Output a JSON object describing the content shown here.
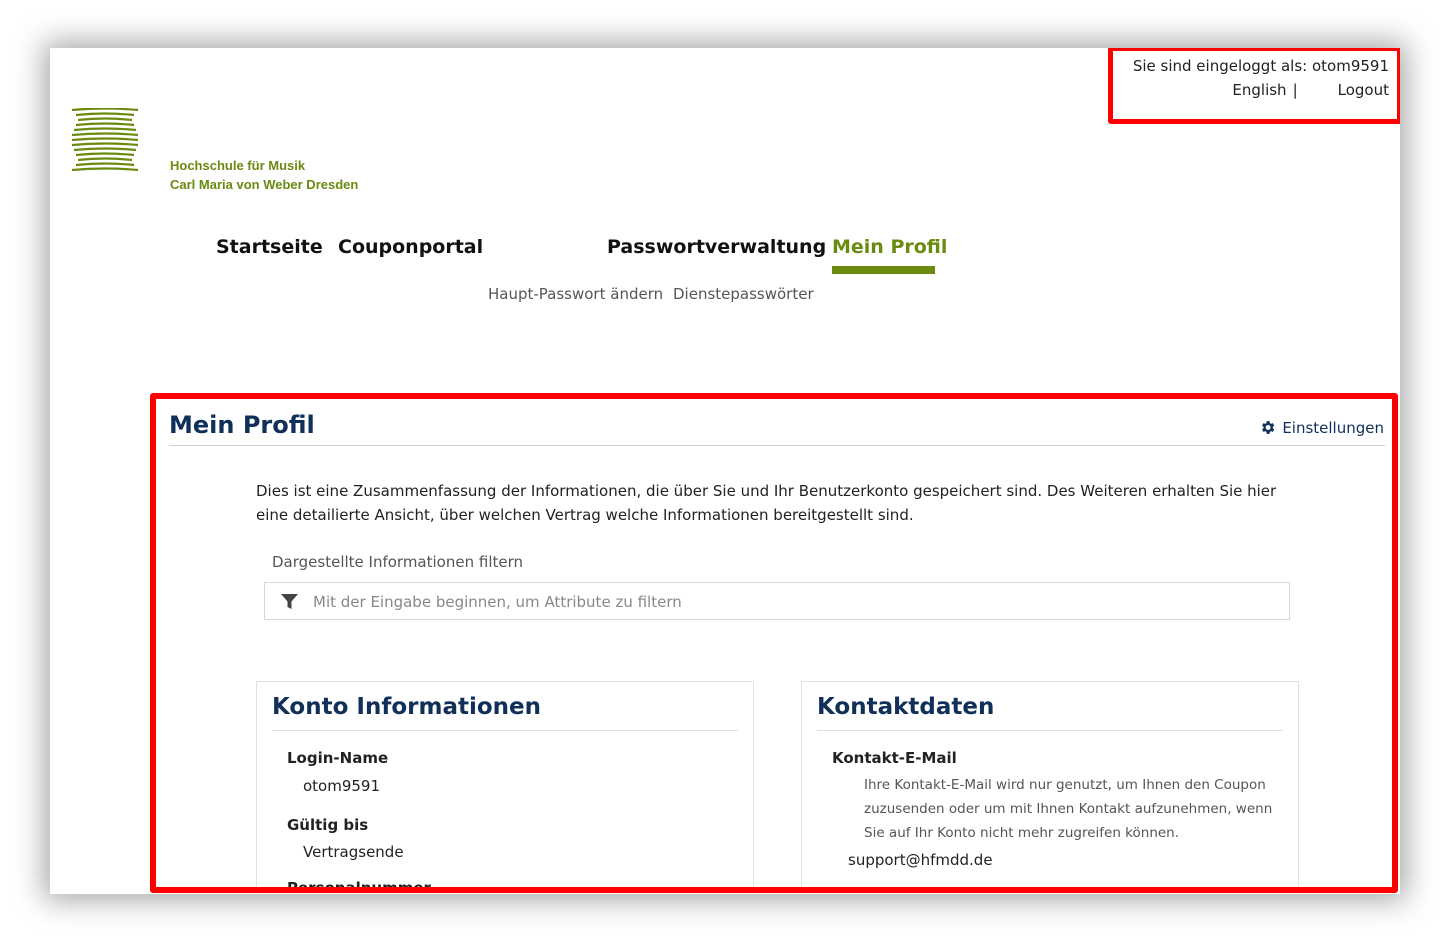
{
  "user": {
    "logged_in_text": "Sie sind eingeloggt als: otom9591",
    "language_link": "English",
    "separator": "|",
    "logout_link": "Logout"
  },
  "logo": {
    "line1": "Hochschule für Musik",
    "line2": "Carl Maria von Weber Dresden",
    "color": "#6a8a10"
  },
  "nav": {
    "items": [
      {
        "label": "Startseite"
      },
      {
        "label": "Couponportal"
      },
      {
        "label": "Passwortverwaltung"
      },
      {
        "label": "Mein Profil",
        "active": true
      }
    ],
    "subitems": [
      {
        "label": "Haupt-Passwort ändern"
      },
      {
        "label": "Dienstepasswörter"
      }
    ]
  },
  "main": {
    "title": "Mein Profil",
    "settings_label": "Einstellungen",
    "intro": "Dies ist eine Zusammenfassung der Informationen, die über Sie und Ihr Benutzerkonto gespeichert sind. Des Weiteren erhalten Sie hier eine detailierte Ansicht, über welchen Vertrag welche Informationen bereitgestellt sind.",
    "filter_label": "Dargestellte Informationen filtern",
    "filter_placeholder": "Mit der Eingabe beginnen, um Attribute zu filtern"
  },
  "cards": {
    "account": {
      "title": "Konto Informationen",
      "login_label": "Login-Name",
      "login_value": "otom9591",
      "valid_label": "Gültig bis",
      "valid_value": "Vertragsende",
      "next_label": "Personalnummer"
    },
    "contact": {
      "title": "Kontaktdaten",
      "email_label": "Kontakt-E-Mail",
      "email_desc": "Ihre Kontakt-E-Mail wird nur genutzt, um Ihnen den Coupon zuzusenden oder um mit Ihnen Kontakt aufzunehmen, wenn Sie auf Ihr Konto nicht mehr zugreifen können.",
      "email_value": "support@hfmdd.de"
    }
  },
  "colors": {
    "accent": "#6a8a10",
    "heading": "#10305a",
    "highlight": "#ff0000"
  },
  "icons": {
    "settings": "gear-icon",
    "filter": "filter-icon",
    "logo": "logo-icon"
  }
}
